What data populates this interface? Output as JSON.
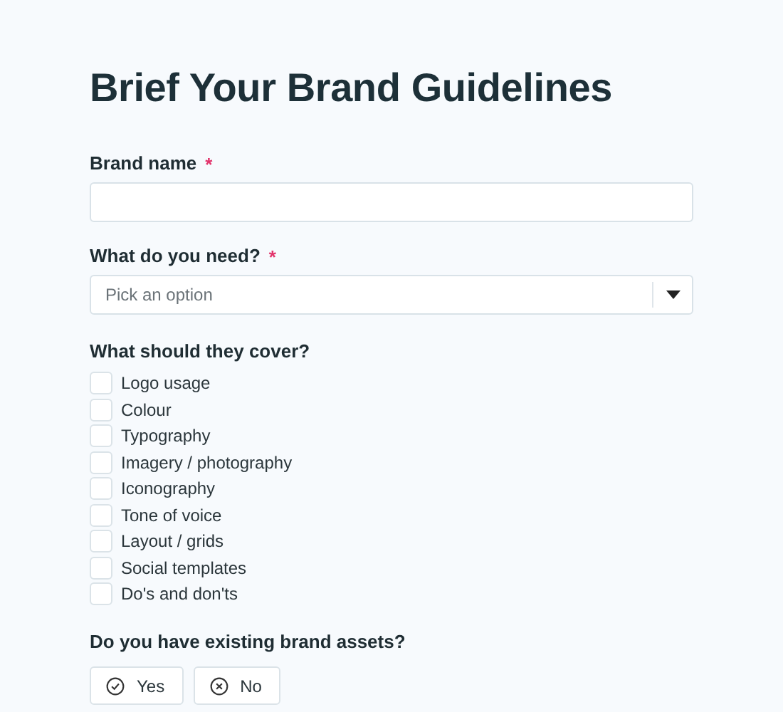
{
  "title": "Brief Your Brand Guidelines",
  "brand_name": {
    "label": "Brand name",
    "required_mark": "*"
  },
  "need": {
    "label": "What do you need?",
    "required_mark": "*",
    "placeholder": "Pick an option"
  },
  "cover": {
    "label": "What should they cover?",
    "options": [
      {
        "label": "Logo usage",
        "checked": false
      },
      {
        "label": "Colour",
        "checked": false
      },
      {
        "label": "Typography",
        "checked": false
      },
      {
        "label": "Imagery / photography",
        "checked": false
      },
      {
        "label": "Iconography",
        "checked": false
      },
      {
        "label": "Tone of voice",
        "checked": false
      },
      {
        "label": "Layout / grids",
        "checked": false
      },
      {
        "label": "Social templates",
        "checked": false
      },
      {
        "label": "Do's and don'ts",
        "checked": false
      }
    ]
  },
  "assets": {
    "label": "Do you have existing brand assets?",
    "choices": [
      {
        "label": "Yes",
        "kind": "check",
        "selected": false
      },
      {
        "label": "No",
        "kind": "cross",
        "selected": false
      }
    ]
  }
}
